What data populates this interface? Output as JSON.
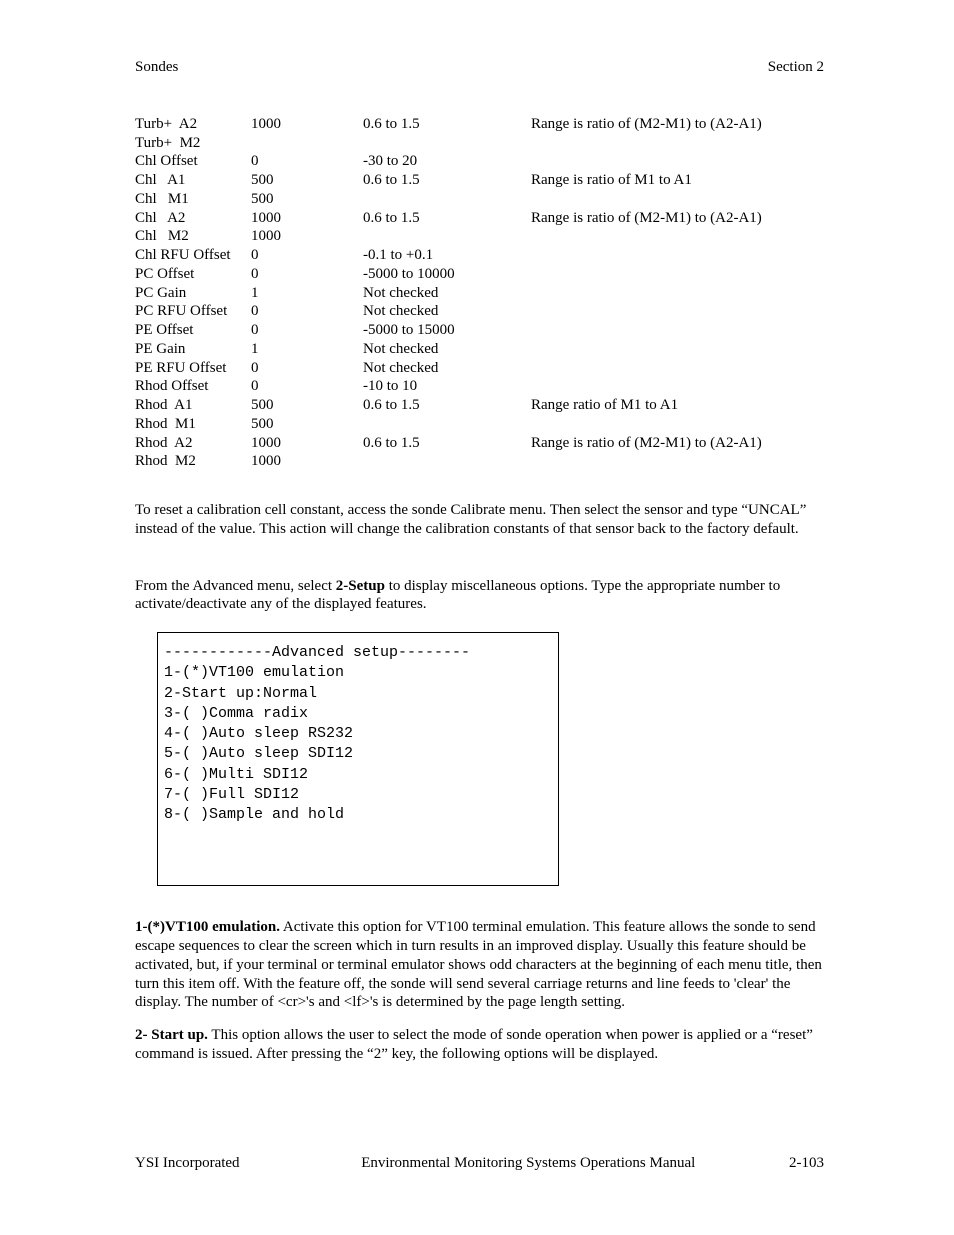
{
  "header": {
    "left": "Sondes",
    "right": "Section 2"
  },
  "cal_rows": [
    {
      "param": "Turb+  A2",
      "def": "1000",
      "range": "0.6 to 1.5",
      "note": "Range is ratio of (M2-M1) to (A2-A1)"
    },
    {
      "param": "Turb+  M2",
      "def": "",
      "range": "",
      "note": ""
    },
    {
      "param": "Chl Offset",
      "def": "0",
      "range": "-30 to 20",
      "note": ""
    },
    {
      "param": "Chl   A1",
      "def": "500",
      "range": "0.6 to 1.5",
      "note": "Range is ratio of M1 to A1"
    },
    {
      "param": "Chl   M1",
      "def": "500",
      "range": "",
      "note": ""
    },
    {
      "param": "Chl   A2",
      "def": "1000",
      "range": "0.6 to 1.5",
      "note": "Range is ratio of (M2-M1) to (A2-A1)"
    },
    {
      "param": "Chl   M2",
      "def": "1000",
      "range": "",
      "note": ""
    },
    {
      "param": "Chl RFU Offset",
      "def": "0",
      "range": "-0.1 to +0.1",
      "note": ""
    },
    {
      "param": "PC Offset",
      "def": "0",
      "range": "-5000 to 10000",
      "note": ""
    },
    {
      "param": "PC Gain",
      "def": "1",
      "range": "Not checked",
      "note": ""
    },
    {
      "param": "PC RFU Offset",
      "def": "0",
      "range": "Not checked",
      "note": ""
    },
    {
      "param": "PE Offset",
      "def": "0",
      "range": "-5000 to 15000",
      "note": ""
    },
    {
      "param": "PE Gain",
      "def": "1",
      "range": "Not checked",
      "note": ""
    },
    {
      "param": "PE RFU Offset",
      "def": "0",
      "range": "Not checked",
      "note": ""
    },
    {
      "param": "Rhod Offset",
      "def": "0",
      "range": "-10 to 10",
      "note": ""
    },
    {
      "param": "Rhod  A1",
      "def": "500",
      "range": "0.6 to 1.5",
      "note": "Range ratio of M1 to A1"
    },
    {
      "param": "Rhod  M1",
      "def": "500",
      "range": "",
      "note": ""
    },
    {
      "param": "Rhod  A2",
      "def": "1000",
      "range": "0.6 to 1.5",
      "note": "Range is ratio of (M2-M1) to (A2-A1)"
    },
    {
      "param": "Rhod  M2",
      "def": "1000",
      "range": "",
      "note": ""
    }
  ],
  "paragraphs": {
    "reset": "To reset a calibration cell constant, access the sonde Calibrate menu.  Then select the sensor and type “UNCAL” instead of the value.  This action will change the calibration constants of that sensor back to the factory default.",
    "setup_pre": "From the Advanced menu, select ",
    "setup_bold": "2-Setup",
    "setup_post": " to display miscellaneous options. Type the appropriate number to activate/deactivate any of the displayed features."
  },
  "menu_lines": [
    "------------Advanced setup--------",
    "1-(*)VT100 emulation",
    "2-Start up:Normal",
    "3-( )Comma radix",
    "4-( )Auto sleep RS232",
    "5-( )Auto sleep SDI12",
    "6-( )Multi SDI12",
    "7-( )Full SDI12",
    "8-( )Sample and hold"
  ],
  "desc": {
    "d1_bold": "1-(*)VT100 emulation.",
    "d1_text": "  Activate this option for VT100 terminal emulation.  This feature allows the sonde to send escape sequences to clear the screen which in turn results in an improved display.  Usually this feature should be activated, but, if your terminal or terminal emulator shows odd characters at the beginning of each menu title, then turn this item off.  With the feature off, the sonde will send several carriage returns and line feeds to 'clear' the display.  The number of <cr>'s and <lf>'s is determined by the page length setting.",
    "d2_bold": "2- Start up.",
    "d2_text": "  This option allows the user to select the mode of sonde operation when power is applied or a “reset” command is issued.   After pressing the “2” key, the following options will be displayed."
  },
  "footer": {
    "left": "YSI Incorporated",
    "center": "Environmental Monitoring Systems Operations Manual",
    "right": "2-103"
  }
}
